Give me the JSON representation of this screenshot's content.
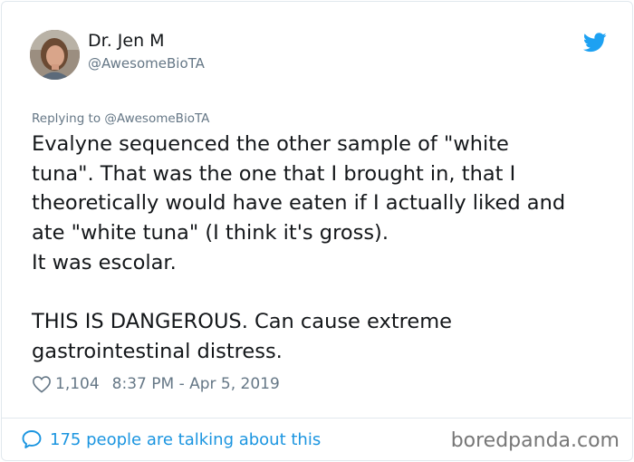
{
  "author": {
    "display_name": "Dr. Jen M",
    "handle": "@AwesomeBioTA",
    "avatar_icon": "profile-photo"
  },
  "header_icon": "twitter-bird-icon",
  "tweet": {
    "replying_to": "Replying to @AwesomeBioTA",
    "lines": [
      "Evalyne sequenced the other sample of \"white",
      "tuna\". That was the one that I brought in, that I",
      "theoretically would have eaten if I actually liked and",
      "ate \"white tuna\" (I think it's gross).",
      "It was escolar.",
      "",
      "THIS IS DANGEROUS. Can cause extreme",
      "gastrointestinal distress."
    ],
    "likes": "1,104",
    "timestamp": "8:37 PM - Apr 5, 2019"
  },
  "footer": {
    "talking_text": "175 people are talking about this",
    "watermark": "boredpanda.com"
  },
  "colors": {
    "text": "#14171a",
    "secondary": "#657786",
    "link": "#1b95e0",
    "twitter_blue": "#1da1f2",
    "border": "#e1e8ed"
  }
}
